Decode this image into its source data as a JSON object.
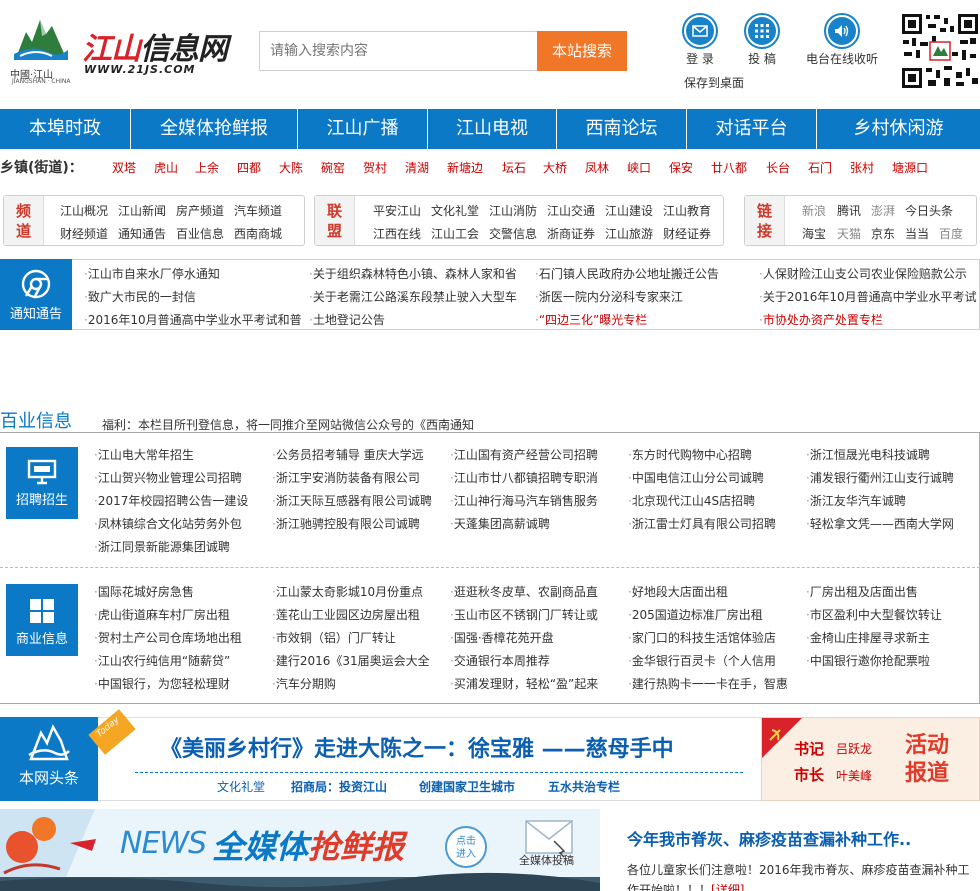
{
  "header": {
    "logo_cn": "中國·江山",
    "logo_en": "JIANGSHAN · CHINA",
    "site_title_a": "江山",
    "site_title_b": "信息网",
    "site_url": "WWW.21JS.COM",
    "search_placeholder": "请输入搜索内容",
    "search_button": "本站搜索",
    "login": "登 录",
    "submit": "投 稿",
    "radio": "电台在线收听",
    "save_desktop": "保存到桌面"
  },
  "nav": [
    "本埠时政",
    "全媒体抢鲜报",
    "江山广播",
    "江山电视",
    "西南论坛",
    "对话平台",
    "乡村休闲游"
  ],
  "towns": {
    "label": "乡镇(街道)：",
    "items": [
      "双塔",
      "虎山",
      "上余",
      "四都",
      "大陈",
      "碗窑",
      "贺村",
      "清湖",
      "新塘边",
      "坛石",
      "大桥",
      "凤林",
      "峡口",
      "保安",
      "廿八都",
      "长台",
      "石门",
      "张村",
      "塘源口"
    ]
  },
  "channels": {
    "pindao": {
      "label1": "频",
      "label2": "道",
      "row1": [
        "江山概况",
        "江山新闻",
        "房产频道",
        "汽车频道"
      ],
      "row2": [
        "财经频道",
        "通知通告",
        "百业信息",
        "西南商城"
      ]
    },
    "lianmeng": {
      "label1": "联",
      "label2": "盟",
      "row1": [
        "平安江山",
        "文化礼堂",
        "江山消防",
        "江山交通",
        "江山建设",
        "江山教育"
      ],
      "row2": [
        "江西在线",
        "江山工会",
        "交警信息",
        "浙商证券",
        "江山旅游",
        "财经证券"
      ]
    },
    "lianjie": {
      "label1": "链",
      "label2": "接",
      "row1": [
        "新浪",
        "腾讯",
        "澎湃",
        "今日头条"
      ],
      "row2": [
        "海宝",
        "天猫",
        "京东",
        "当当",
        "百度"
      ]
    }
  },
  "notice": {
    "label": "通知通告",
    "col1": [
      "江山市自来水厂停水通知",
      "致广大市民的一封信",
      "2016年10月普通高中学业水平考试和普"
    ],
    "col2": [
      "关于组织森林特色小镇、森林人家和省",
      "关于老需江公路溪东段禁止驶入大型车",
      "土地登记公告"
    ],
    "col3": [
      "石门镇人民政府办公地址搬迁公告",
      "浙医一院内分泌科专家来江",
      "“四边三化”曝光专栏"
    ],
    "col4": [
      "人保财险江山支公司农业保险赔款公示",
      "关于2016年10月普通高中学业水平考试",
      "市协处办资产处置专栏"
    ]
  },
  "baiye": {
    "title": "百业信息",
    "note": "福利：本栏目所刊登信息，将一同推介至网站微信公众号的《西南通知",
    "recruit_label": "招聘招生",
    "recruit": [
      [
        "江山电大常年招生",
        "江山贺兴物业管理公司招聘",
        "2017年校园招聘公告一建设",
        "凤林镇综合文化站劳务外包",
        "浙江同景新能源集团诚聘"
      ],
      [
        "公务员招考辅导 重庆大学远",
        "浙江宇安消防装备有限公司",
        "浙江天际互感器有限公司诚聘",
        "浙江驰骋控股有限公司诚聘"
      ],
      [
        "江山国有资产经营公司招聘",
        "江山市廿八都镇招聘专职消",
        "江山神行海马汽车销售服务",
        "天蓬集团高薪诚聘"
      ],
      [
        "东方时代购物中心招聘",
        "中国电信江山分公司诚聘",
        "北京现代江山4S店招聘",
        "浙江雷士灯具有限公司招聘"
      ],
      [
        "浙江恒晟光电科技诚聘",
        "浦发银行衢州江山支行诚聘",
        "浙江友华汽车诚聘",
        "轻松拿文凭——西南大学网"
      ]
    ],
    "biz_label": "商业信息",
    "biz": [
      [
        "国际花城好房急售",
        "虎山街道麻车村厂房出租",
        "贺村土产公司仓库场地出租",
        "江山农行纯信用“随薪贷”",
        "中国银行，为您轻松理财"
      ],
      [
        "江山蒙太奇影城10月份重点",
        "莲花山工业园区边房屋出租",
        "市效铜（铝）门厂转让",
        "建行2016《31届奥运会大全",
        "汽车分期购"
      ],
      [
        "逛逛秋冬皮草、农副商品直",
        "玉山市区不锈钢门厂转让或",
        "国强·香樟花苑开盘",
        "交通银行本周推荐",
        "买浦发理财，轻松“盈”起来"
      ],
      [
        "好地段大店面出租",
        "205国道边标准厂房出租",
        "家门口的科技生活馆体验店",
        "金华银行百灵卡（个人信用",
        "建行热购卡一一卡在手，智惠"
      ],
      [
        "厂房出租及店面出售",
        "市区盈利中大型餐饮转让",
        "金椅山庄排屋寻求新主",
        "中国银行邀你抢配票啦"
      ]
    ]
  },
  "headline": {
    "label": "本网头条",
    "today": "Today",
    "title": "《美丽乡村行》走进大陈之一：徐宝雅 ——慈母手中",
    "subs": [
      "文化礼堂",
      "招商局：投资江山",
      "创建国家卫生城市",
      "五水共治专栏"
    ],
    "shuji": "书记",
    "shuji_name": "吕跃龙",
    "shizhang": "市长",
    "shizhang_name": "叶美峰",
    "huodong1": "活动",
    "huodong2": "报道"
  },
  "bottom": {
    "news": "NEWS",
    "qmt_a": "全媒体",
    "qmt_b": "抢鲜报",
    "enter1": "点击",
    "enter2": "进入",
    "tougao": "全媒体投稿",
    "news_title": "今年我市脊灰、麻疹疫苗查漏补种工作..",
    "news_body": "各位儿童家长们注意啦！2016年我市脊灰、麻疹疫苗查漏补种工作开始啦！！！",
    "detail": "[详细]"
  }
}
